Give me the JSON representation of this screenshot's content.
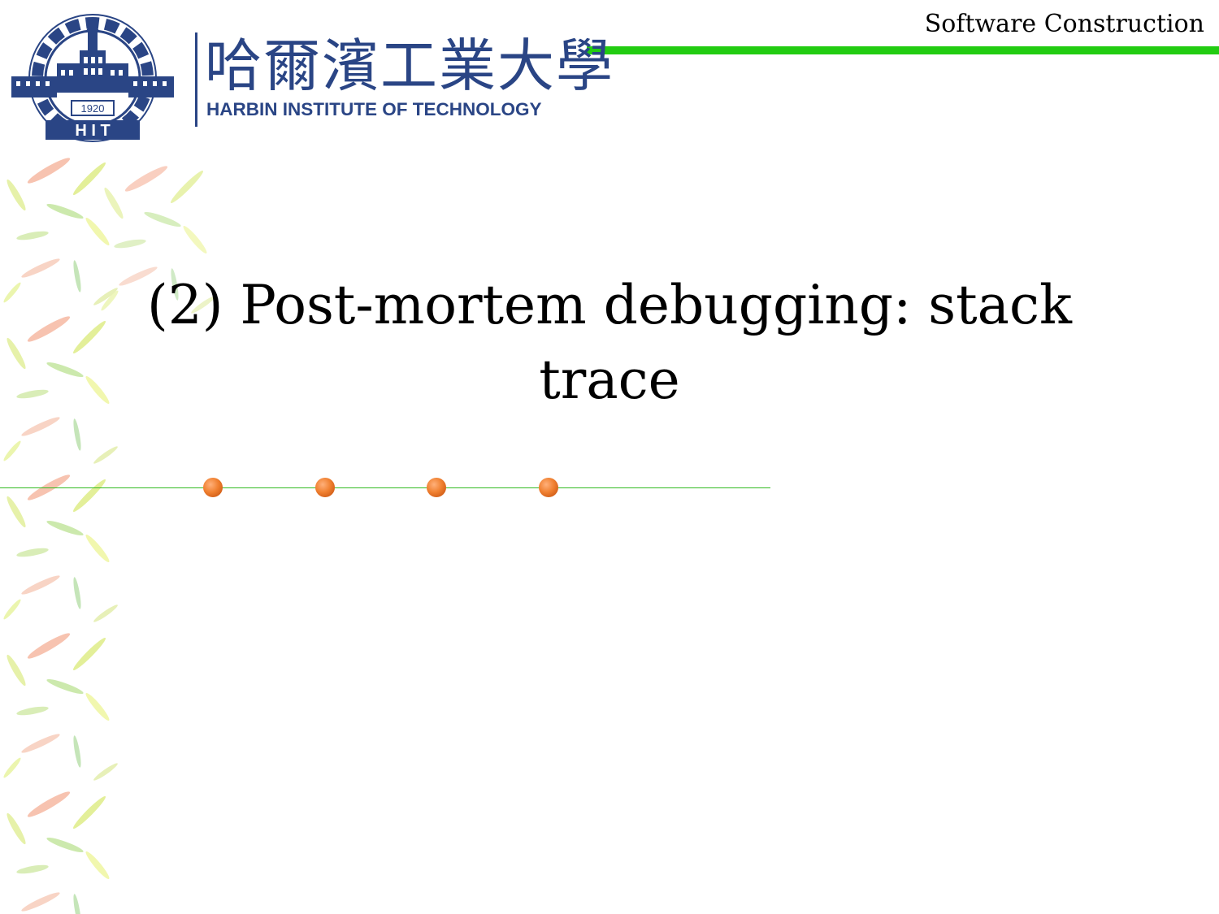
{
  "header": {
    "course_title": "Software Construction",
    "accent_color": "#22cc11"
  },
  "logo": {
    "name_cn": "哈爾濱工業大學",
    "name_en": "HARBIN INSTITUTE OF TECHNOLOGY",
    "year": "1920",
    "emblem_letters": "H I T",
    "color": "#2a4585"
  },
  "slide": {
    "title": "(2) Post-mortem debugging: stack trace"
  },
  "decoration": {
    "dot_color": "#f08030",
    "bullet_dot_count": 4
  }
}
